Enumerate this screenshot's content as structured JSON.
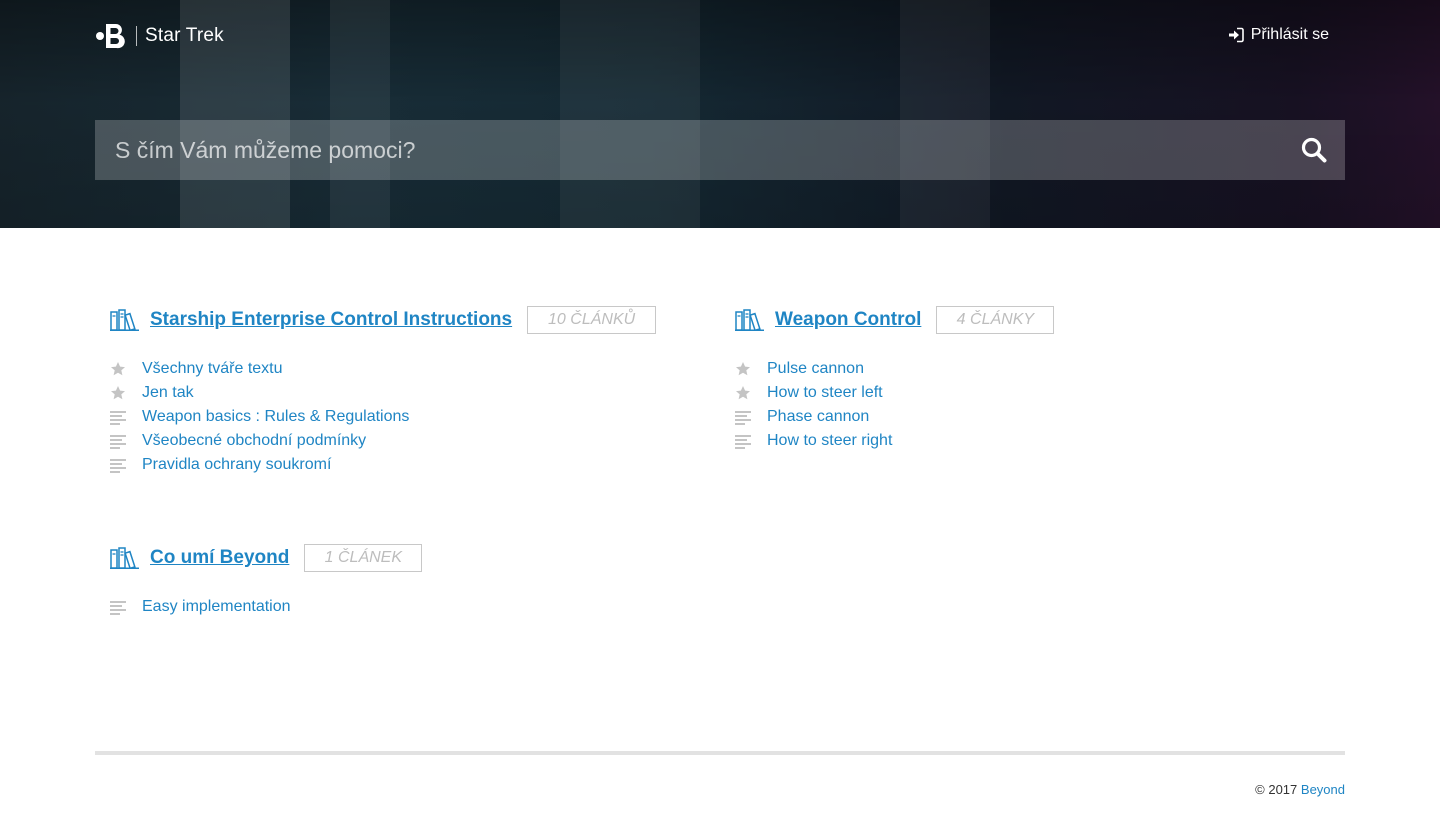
{
  "header": {
    "brand_name": "Star Trek",
    "login_label": "Přihlásit se"
  },
  "search": {
    "placeholder": "S čím Vám můžeme pomoci?"
  },
  "categories": [
    {
      "title": "Starship Enterprise Control Instructions",
      "badge": "10 ČLÁNKŮ",
      "articles": [
        {
          "label": "Všechny tváře textu",
          "icon": "star-icon"
        },
        {
          "label": "Jen tak",
          "icon": "star-icon"
        },
        {
          "label": "Weapon basics : Rules & Regulations",
          "icon": "text-lines-icon"
        },
        {
          "label": "Všeobecné obchodní podmínky",
          "icon": "text-lines-icon"
        },
        {
          "label": "Pravidla ochrany soukromí",
          "icon": "text-lines-icon"
        }
      ]
    },
    {
      "title": "Weapon Control",
      "badge": "4 ČLÁNKY",
      "articles": [
        {
          "label": "Pulse cannon",
          "icon": "star-icon"
        },
        {
          "label": "How to steer left",
          "icon": "star-icon"
        },
        {
          "label": "Phase cannon",
          "icon": "text-lines-icon"
        },
        {
          "label": "How to steer right",
          "icon": "text-lines-icon"
        }
      ]
    },
    {
      "title": "Co umí Beyond",
      "badge": "1 ČLÁNEK",
      "articles": [
        {
          "label": "Easy implementation",
          "icon": "text-lines-icon"
        }
      ]
    }
  ],
  "footer": {
    "copyright": "© 2017",
    "link_label": "Beyond"
  },
  "colors": {
    "link": "#1f85c4",
    "icon_gray": "#c4c4c4",
    "badge_border": "#c8c8c8"
  }
}
